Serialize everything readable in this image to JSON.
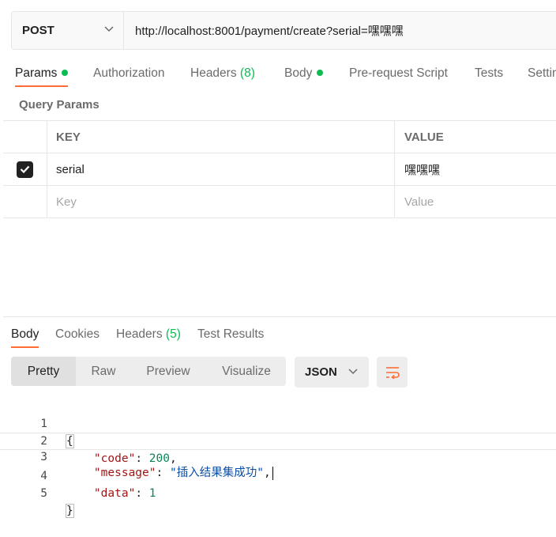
{
  "request": {
    "method": "POST",
    "url": "http://localhost:8001/payment/create?serial=嘿嘿嘿"
  },
  "request_tabs": [
    {
      "label": "Params",
      "dot": true,
      "active": true
    },
    {
      "label": "Authorization"
    },
    {
      "label": "Headers",
      "count": "(8)"
    },
    {
      "label": "Body",
      "dot": true
    },
    {
      "label": "Pre-request Script"
    },
    {
      "label": "Tests"
    },
    {
      "label": "Settin"
    }
  ],
  "query_params": {
    "title": "Query Params",
    "headers": {
      "key": "KEY",
      "value": "VALUE"
    },
    "rows": [
      {
        "checked": true,
        "key": "serial",
        "value": "嘿嘿嘿"
      }
    ],
    "placeholder": {
      "key": "Key",
      "value": "Value"
    }
  },
  "response_tabs": [
    {
      "label": "Body",
      "active": true
    },
    {
      "label": "Cookies"
    },
    {
      "label": "Headers",
      "count": "(5)"
    },
    {
      "label": "Test Results"
    }
  ],
  "view_modes": [
    "Pretty",
    "Raw",
    "Preview",
    "Visualize"
  ],
  "active_view_mode": "Pretty",
  "format": "JSON",
  "icons": {
    "method_dropdown": "chevron-down-icon",
    "checkbox": "checkmark-icon",
    "format_dropdown": "chevron-down-icon",
    "wrap": "text-wrap-icon"
  },
  "colors": {
    "accent": "#ff6c37",
    "status_dot": "#0cbb52",
    "json_key": "#a31515",
    "json_string": "#0a4ea6",
    "json_number": "#098658"
  },
  "response_body": {
    "line_numbers": [
      "1",
      "2",
      "3",
      "4",
      "5"
    ],
    "open_brace": "{",
    "close_brace": "}",
    "code_key": "\"code\"",
    "code_value": "200",
    "message_key": "\"message\"",
    "message_value": "\"插入结果集成功\"",
    "data_key": "\"data\"",
    "data_value": "1"
  }
}
